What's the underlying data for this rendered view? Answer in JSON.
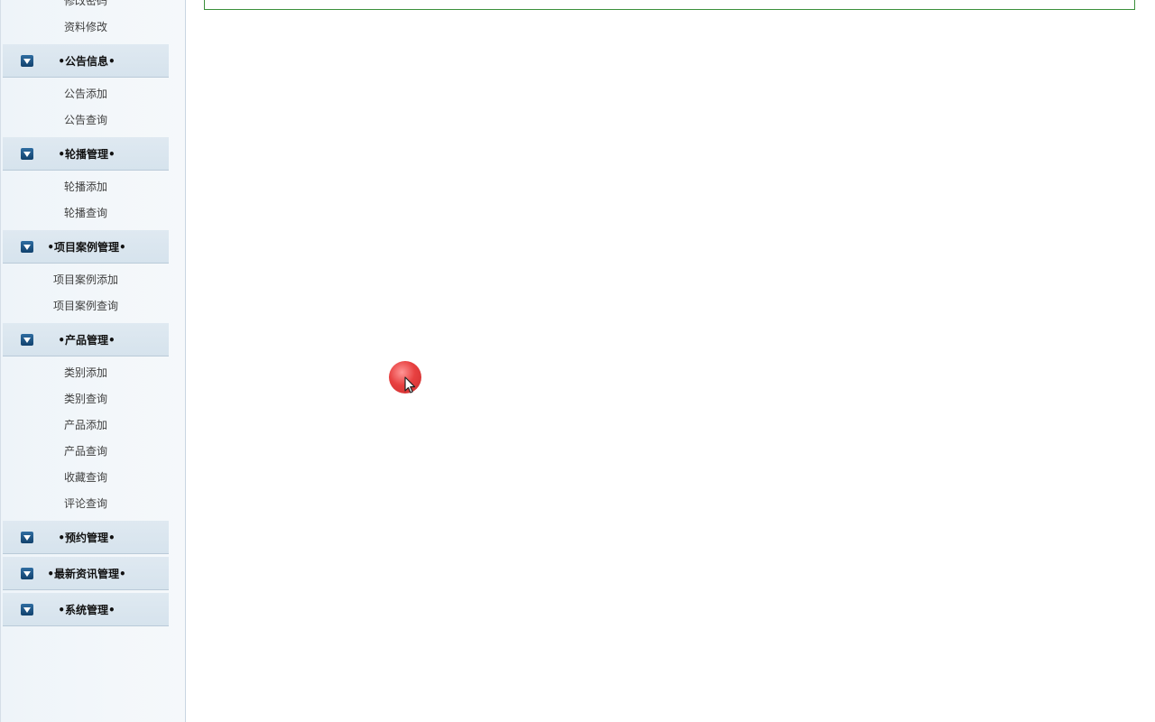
{
  "sidebar": {
    "partial_items": [
      "修改密码",
      "资料修改"
    ],
    "groups": [
      {
        "title": "•公告信息•",
        "items": [
          "公告添加",
          "公告查询"
        ]
      },
      {
        "title": "•轮播管理•",
        "items": [
          "轮播添加",
          "轮播查询"
        ]
      },
      {
        "title": "•项目案例管理•",
        "items": [
          "项目案例添加",
          "项目案例查询"
        ]
      },
      {
        "title": "•产品管理•",
        "items": [
          "类别添加",
          "类别查询",
          "产品添加",
          "产品查询",
          "收藏查询",
          "评论查询"
        ]
      },
      {
        "title": "•预约管理•",
        "items": []
      },
      {
        "title": "•最新资讯管理•",
        "items": []
      },
      {
        "title": "•系统管理•",
        "items": []
      }
    ]
  },
  "icons": {
    "group_toggle": "chevron-down-icon",
    "pointer": "mouse-pointer-icon"
  },
  "colors": {
    "header_bg": "#d6e3ed",
    "arrow_bg": "#11416d",
    "content_border": "#3a8f3a",
    "cursor_highlight": "#e52b2b"
  }
}
